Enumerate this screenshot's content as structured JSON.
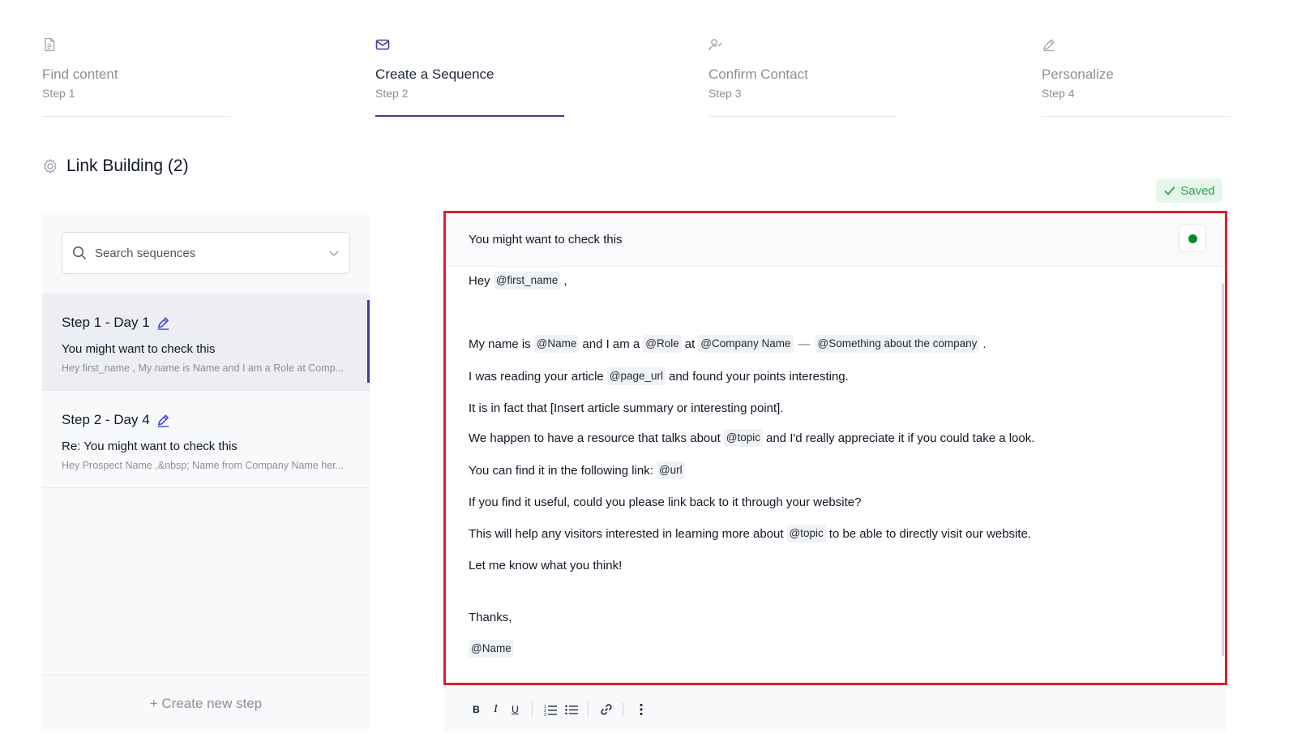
{
  "stepper": [
    {
      "title": "Find content",
      "sub": "Step 1"
    },
    {
      "title": "Create a Sequence",
      "sub": "Step 2"
    },
    {
      "title": "Confirm Contact",
      "sub": "Step 3"
    },
    {
      "title": "Personalize",
      "sub": "Step 4"
    }
  ],
  "page": {
    "title": "Link Building (2)",
    "saved_label": "Saved"
  },
  "sidebar": {
    "search_placeholder": "Search sequences",
    "items": [
      {
        "head": "Step 1 - Day 1",
        "subject": "You might want to check this",
        "preview": "Hey first_name ,  My name is Name and I am a Role at Comp..."
      },
      {
        "head": "Step 2 - Day 4",
        "subject": "Re: You might want to check this",
        "preview": "Hey Prospect Name ,&nbsp; Name from Company Name her..."
      }
    ],
    "create_label": "+  Create new step"
  },
  "editor": {
    "subject": "You might want to check this",
    "body": {
      "l1_a": "Hey",
      "l1_tag": "@first_name",
      "l1_b": ",",
      "l2_a": "My name is",
      "l2_tag1": "@Name",
      "l2_b": "and I am a",
      "l2_tag2": "@Role",
      "l2_c": "at",
      "l2_tag3": "@Company Name",
      "l2_sep": "—",
      "l2_tag4": "@Something about the company",
      "l2_d": ".",
      "l3_a": "I was reading your article",
      "l3_tag": "@page_url",
      "l3_b": "and found your points interesting.",
      "l4": "It is in fact that [Insert article summary or interesting point].",
      "l5_a": "We happen to have a resource that talks about",
      "l5_tag": "@topic",
      "l5_b": "and I'd really appreciate it if you could take a look.",
      "l6_a": "You can find it in the following link:",
      "l6_tag": "@url",
      "l7": "If you find it useful, could you please link back to it through your website?",
      "l8_a": "This will help any visitors interested in learning more about",
      "l8_tag": "@topic",
      "l8_b": "to be able to directly visit our website.",
      "l9": "Let me know what you think!",
      "l10": "Thanks,",
      "l11_tag": "@Name"
    }
  },
  "toolbar": {
    "bold": "B",
    "italic": "I",
    "underline": "U"
  },
  "colors": {
    "accent": "#3b3f9c",
    "highlight_border": "#e11d2a",
    "saved_green": "#2fa04a",
    "status_dot": "#0b8a2a"
  }
}
